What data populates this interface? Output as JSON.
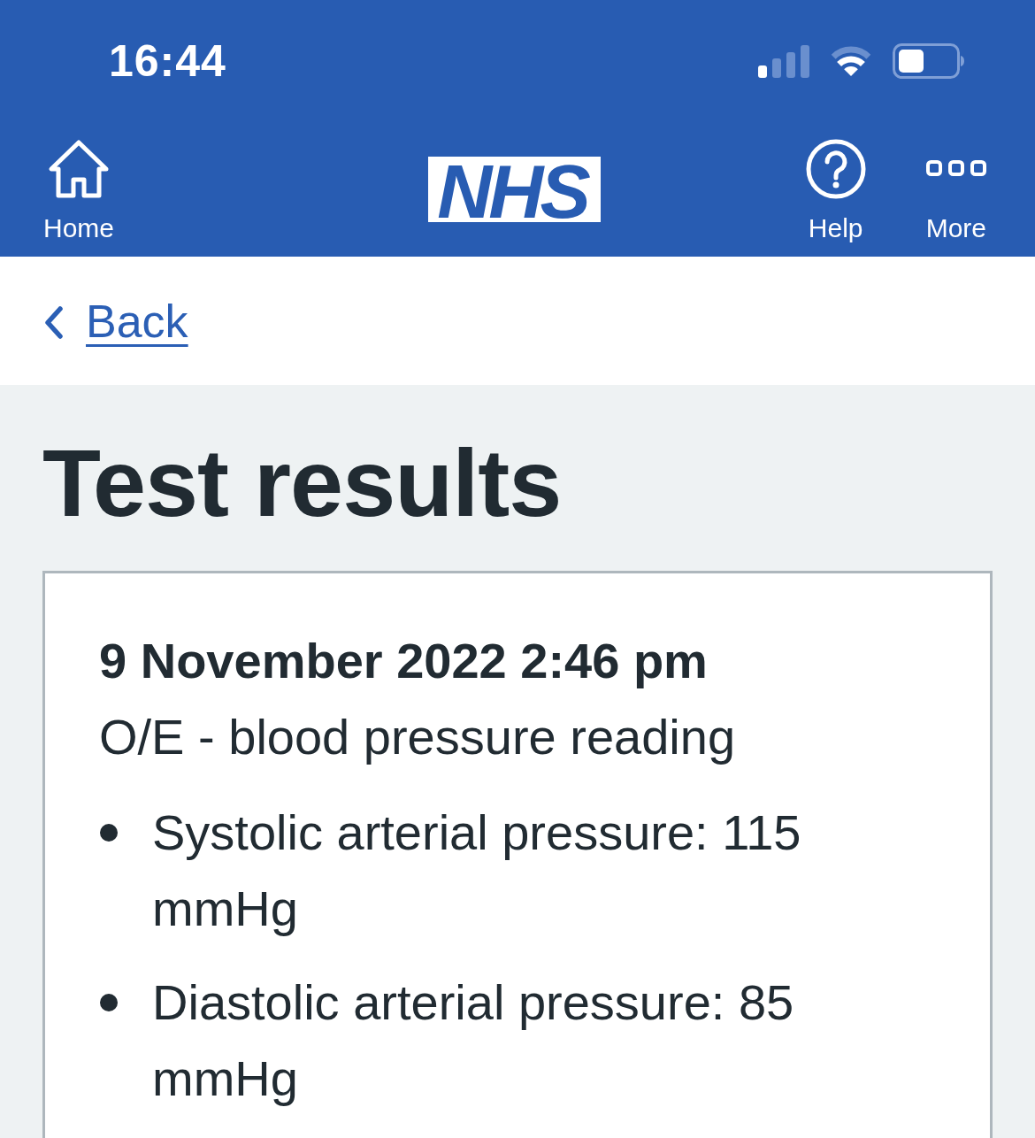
{
  "status_bar": {
    "time": "16:44"
  },
  "header": {
    "left_items": [
      {
        "label": "Home"
      }
    ],
    "logo": "NHS",
    "right_items": [
      {
        "label": "Help"
      },
      {
        "label": "More"
      }
    ]
  },
  "back_link": {
    "label": "Back"
  },
  "page": {
    "title": "Test results"
  },
  "result_card": {
    "date": "9 November 2022 2:46 pm",
    "description": "O/E - blood pressure reading",
    "values": [
      "Systolic arterial pressure: 115 mmHg",
      "Diastolic arterial pressure: 85 mmHg"
    ]
  }
}
